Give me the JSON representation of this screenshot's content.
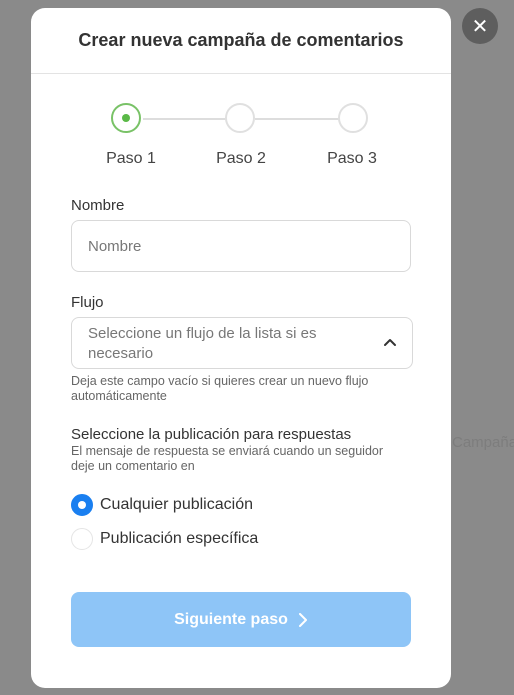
{
  "background": {
    "partial_text": "Campaña"
  },
  "close_icon_glyph": "✕",
  "modal": {
    "title": "Crear nueva campaña de comentarios",
    "steps": [
      {
        "label": "Paso 1",
        "state": "active"
      },
      {
        "label": "Paso 2",
        "state": "inactive"
      },
      {
        "label": "Paso 3",
        "state": "inactive"
      }
    ],
    "name_field": {
      "label": "Nombre",
      "value": "",
      "placeholder": "Nombre"
    },
    "flow_field": {
      "label": "Flujo",
      "placeholder": "Seleccione un flujo de la lista si es necesario",
      "hint": "Deja este campo vacío si quieres crear un nuevo flujo automáticamente"
    },
    "publication": {
      "title": "Seleccione la publicación para respuestas",
      "description": "El mensaje de respuesta se enviará cuando un seguidor deje un comentario en",
      "options": [
        {
          "label": "Cualquier publicación",
          "checked": true
        },
        {
          "label": "Publicación específica",
          "checked": false
        }
      ]
    },
    "next_button": {
      "label": "Siguiente paso"
    }
  },
  "colors": {
    "accent_green": "#5ab947",
    "radio_blue": "#1a7ff0",
    "button_disabled": "#8ec5f7",
    "overlay": "#8a8a8a"
  }
}
